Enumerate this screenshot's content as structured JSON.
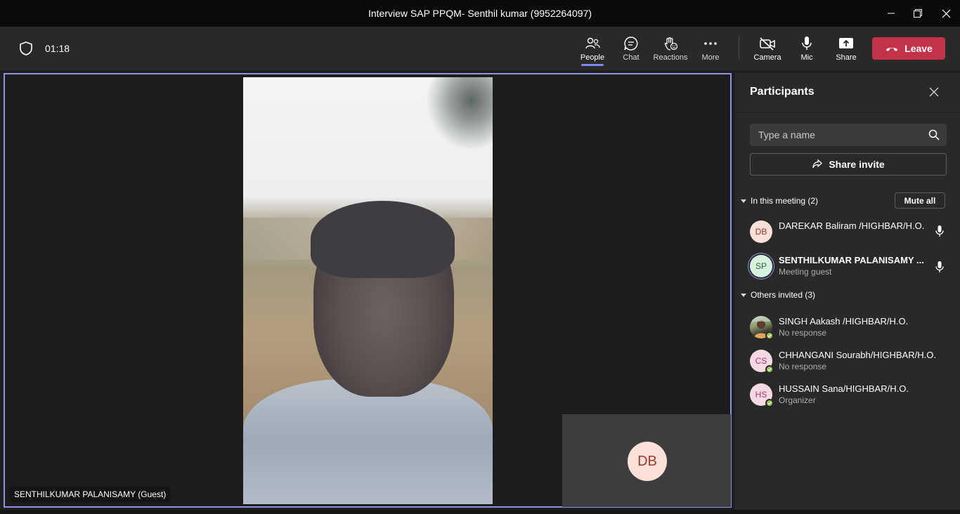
{
  "window": {
    "title": "Interview SAP PPQM- Senthil kumar (9952264097)"
  },
  "toolbar": {
    "timer": "01:18",
    "people_label": "People",
    "chat_label": "Chat",
    "reactions_label": "Reactions",
    "more_label": "More",
    "camera_label": "Camera",
    "mic_label": "Mic",
    "share_label": "Share",
    "leave_label": "Leave",
    "leave_color": "#c4314b",
    "accent_color": "#7f85f5"
  },
  "stage": {
    "speaker_name_tag": "SENTHILKUMAR PALANISAMY (Guest)",
    "self_avatar_initials": "DB"
  },
  "participants_panel": {
    "title": "Participants",
    "search_placeholder": "Type a name",
    "share_invite_label": "Share invite",
    "in_meeting_label": "In this meeting (2)",
    "mute_all_label": "Mute all",
    "in_meeting": [
      {
        "initials": "DB",
        "name": "DAREKAR Baliram /HIGHBAR/H.O.",
        "subtitle": ""
      },
      {
        "initials": "SP",
        "name": "SENTHILKUMAR PALANISAMY ...",
        "subtitle": "Meeting guest"
      }
    ],
    "others_invited_label": "Others invited (3)",
    "others_invited": [
      {
        "initials": "",
        "name": "SINGH Aakash /HIGHBAR/H.O.",
        "subtitle": "No response"
      },
      {
        "initials": "CS",
        "name": "CHHANGANI Sourabh/HIGHBAR/H.O.",
        "subtitle": "No response"
      },
      {
        "initials": "HS",
        "name": "HUSSAIN Sana/HIGHBAR/H.O.",
        "subtitle": "Organizer"
      }
    ]
  }
}
